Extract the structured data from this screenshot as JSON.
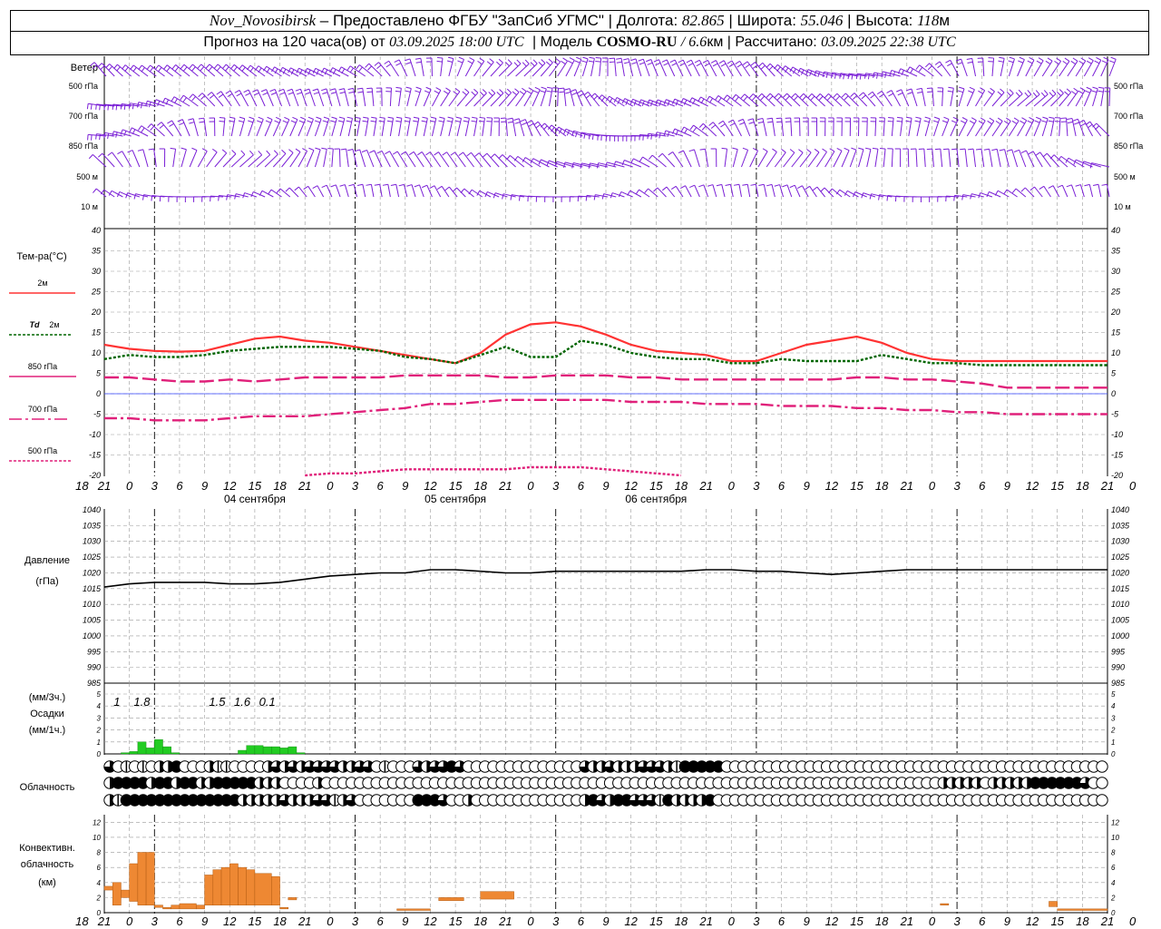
{
  "header": {
    "station": "Nov_Novosibirsk",
    "provider": "– Предоставлено ФГБУ \"ЗапСиб УГМС\"",
    "lon_label": "Долгота:",
    "lon_value": "82.865",
    "lat_label": "Широта:",
    "lat_value": "55.046",
    "alt_label": "Высота:",
    "alt_value": "118",
    "alt_unit": "м",
    "forecast_label": "Прогноз на 120 часа(ов) от",
    "forecast_start": "03.09.2025 18:00 UTC",
    "model_label": "Модель",
    "model_name": "COSMO-RU",
    "model_res": "/ 6.6",
    "model_res_unit": "км",
    "calc_label": "Рассчитано:",
    "calc_time": "03.09.2025 22:38 UTC"
  },
  "chart_data": [
    {
      "type": "wind-barbs",
      "title": "Ветер",
      "levels": [
        "500 гПа",
        "700 гПа",
        "850 гПа",
        "500 м",
        "10 м"
      ],
      "note": "wind barbs every hour for 120 hours at each level"
    },
    {
      "type": "line",
      "title": "Тем-ра(°С)",
      "ylim": [
        -20,
        40
      ],
      "yticks": [
        -20,
        -15,
        -10,
        -5,
        0,
        5,
        10,
        15,
        20,
        25,
        30,
        35,
        40
      ],
      "x_hours": [
        0,
        3,
        6,
        9,
        12,
        15,
        18,
        21,
        24,
        27,
        30,
        33,
        36,
        39,
        42,
        45,
        48,
        51,
        54,
        57,
        60,
        63,
        66,
        69,
        72,
        75,
        78,
        81,
        84,
        87,
        90,
        93,
        96,
        99,
        102,
        105,
        108,
        111,
        114,
        117,
        120
      ],
      "series": [
        {
          "name": "2м",
          "color": "#ff3333",
          "style": "solid",
          "values": [
            12,
            11,
            10.5,
            10.3,
            10.5,
            12,
            13.5,
            14,
            13,
            12.5,
            11.5,
            10.5,
            9.5,
            8.5,
            7.5,
            10,
            14.5,
            17,
            17.5,
            16.5,
            14.5,
            12,
            10.5,
            10,
            9.5,
            8,
            8,
            10,
            12,
            13,
            14,
            12.5,
            10,
            8.5,
            8,
            8,
            8,
            8,
            8,
            8,
            8
          ]
        },
        {
          "name": "Td 2м",
          "color": "#006600",
          "style": "dotted",
          "values": [
            8.5,
            9.5,
            9,
            9,
            9.5,
            10.5,
            11,
            11.5,
            11.5,
            11.5,
            11,
            10.5,
            9,
            8.5,
            7.5,
            9.5,
            11.5,
            9,
            9,
            13,
            12,
            10,
            9,
            8.5,
            8.5,
            7.5,
            7.5,
            8.5,
            8,
            8,
            8,
            9.5,
            8.5,
            7.5,
            7.5,
            7,
            7,
            7,
            7,
            7,
            7
          ]
        },
        {
          "name": "850 гПа",
          "color": "#e0207a",
          "style": "dash",
          "values": [
            4,
            4,
            3.5,
            3,
            3,
            3.5,
            3,
            3.5,
            4,
            4,
            4,
            4,
            4.5,
            4.5,
            4.5,
            4.5,
            4,
            4,
            4.5,
            4.5,
            4.5,
            4,
            4,
            3.5,
            3.5,
            3.5,
            3.5,
            3.5,
            3.5,
            3.5,
            4,
            4,
            3.5,
            3.5,
            3,
            2.5,
            1.5,
            1.5,
            1.5,
            1.5,
            1.5
          ]
        },
        {
          "name": "700 гПа",
          "color": "#e0207a",
          "style": "dashdot",
          "values": [
            -6,
            -6,
            -6.5,
            -6.5,
            -6.5,
            -6,
            -5.5,
            -5.5,
            -5.5,
            -5,
            -4.5,
            -4,
            -3.5,
            -2.5,
            -2.5,
            -2,
            -1.5,
            -1.5,
            -1.5,
            -1.5,
            -1.5,
            -2,
            -2,
            -2,
            -2.5,
            -2.5,
            -2.5,
            -3,
            -3,
            -3,
            -3.5,
            -3.5,
            -4,
            -4,
            -4.5,
            -4.5,
            -5,
            -5,
            -5,
            -5,
            -5
          ]
        },
        {
          "name": "500 гПа",
          "color": "#e0207a",
          "style": "dotted",
          "values": [
            null,
            null,
            null,
            null,
            null,
            null,
            null,
            null,
            -20,
            -19.5,
            -19.5,
            -19,
            -18.5,
            -18.5,
            -18.5,
            -18.5,
            -18.5,
            -18,
            -18,
            -18,
            -18.5,
            -19,
            -19.5,
            -20,
            null,
            null,
            null,
            null,
            null,
            null,
            null,
            null,
            null,
            null,
            null,
            null,
            null,
            null,
            null,
            null,
            null
          ]
        }
      ]
    },
    {
      "type": "line",
      "title": "Давление",
      "ylabel": "(гПа)",
      "ylim": [
        985,
        1040
      ],
      "yticks": [
        985,
        990,
        995,
        1000,
        1005,
        1010,
        1015,
        1020,
        1025,
        1030,
        1035,
        1040
      ],
      "series": [
        {
          "name": "",
          "color": "#000000",
          "values": [
            1015.5,
            1016.5,
            1017,
            1017,
            1017,
            1016.5,
            1016.5,
            1017,
            1018,
            1019,
            1019.5,
            1020,
            1020,
            1021,
            1021,
            1020.5,
            1020,
            1020,
            1020.5,
            1020.5,
            1020.5,
            1020.5,
            1020.5,
            1020.5,
            1021,
            1021,
            1020.5,
            1020.5,
            1020,
            1019.5,
            1020,
            1020.5,
            1021,
            1021,
            1021,
            1021,
            1021,
            1021,
            1021,
            1021,
            1021
          ]
        }
      ]
    },
    {
      "type": "bar",
      "title": "Осадки",
      "ylabel_top": "(мм/3ч.)",
      "ylabel_bottom": "(мм/1ч.)",
      "ylim": [
        0,
        5
      ],
      "yticks": [
        0,
        1,
        2,
        3,
        4,
        5
      ],
      "color": "#22cc22",
      "hourly_start_hours": [
        2,
        3,
        4,
        5,
        6,
        7,
        8,
        16,
        17,
        18,
        19,
        20,
        21,
        22,
        23
      ],
      "hourly_values": [
        0.1,
        0.2,
        1.0,
        0.5,
        1.2,
        0.6,
        0.1,
        0.3,
        0.7,
        0.7,
        0.6,
        0.6,
        0.5,
        0.6,
        0.1
      ],
      "totals_3h": [
        {
          "label": "1",
          "hour": 1.5
        },
        {
          "label": "1.8",
          "hour": 4.5
        },
        {
          "label": "1.5",
          "hour": 13.5
        },
        {
          "label": "1.6",
          "hour": 16.5
        },
        {
          "label": "0.1",
          "hour": 19.5
        }
      ]
    },
    {
      "type": "table",
      "title": "Облачность",
      "legend": "0 clear … 4 overcast, per 1-hour step, three cloud layers (high, middle, low)",
      "rows": [
        [
          3,
          0,
          1,
          0,
          1,
          0,
          2,
          2,
          4,
          0,
          0,
          0,
          2,
          1,
          1,
          0,
          0,
          0,
          0,
          2,
          3,
          2,
          3,
          2,
          3,
          3,
          3,
          3,
          2,
          2,
          3,
          3,
          0,
          1,
          0,
          0,
          0,
          3,
          2,
          3,
          3,
          4,
          3,
          0,
          0,
          0,
          0,
          0,
          0,
          0,
          0,
          0,
          0,
          0,
          0,
          0,
          0,
          3,
          2,
          2,
          3,
          2,
          2,
          2,
          3,
          3,
          3,
          2,
          1,
          4,
          4,
          4,
          4,
          4,
          0,
          0,
          0,
          0,
          0,
          0,
          0,
          0,
          0,
          0,
          0,
          0,
          0,
          0,
          0,
          0,
          0,
          0,
          0,
          0,
          0,
          0,
          0,
          0,
          0,
          0,
          0,
          0,
          0,
          0,
          0,
          0,
          0,
          0,
          0,
          0,
          0,
          0,
          0,
          0,
          0,
          0,
          0,
          0,
          0,
          0
        ],
        [
          2,
          4,
          4,
          4,
          4,
          2,
          4,
          4,
          2,
          4,
          4,
          2,
          2,
          4,
          4,
          4,
          4,
          4,
          2,
          2,
          2,
          0,
          0,
          0,
          0,
          2,
          0,
          0,
          0,
          0,
          0,
          0,
          0,
          0,
          0,
          0,
          0,
          0,
          0,
          0,
          0,
          0,
          0,
          0,
          0,
          0,
          0,
          0,
          0,
          0,
          0,
          0,
          0,
          0,
          0,
          0,
          0,
          0,
          0,
          0,
          0,
          0,
          0,
          0,
          0,
          0,
          0,
          0,
          0,
          0,
          0,
          0,
          0,
          0,
          0,
          0,
          0,
          0,
          0,
          0,
          0,
          0,
          0,
          0,
          0,
          0,
          0,
          0,
          0,
          0,
          0,
          0,
          0,
          0,
          0,
          0,
          0,
          0,
          0,
          0,
          2,
          2,
          2,
          2,
          2,
          0,
          2,
          2,
          2,
          2,
          2,
          4,
          4,
          4,
          4,
          4,
          4,
          3,
          0,
          0
        ],
        [
          2,
          1,
          4,
          4,
          4,
          4,
          4,
          4,
          4,
          4,
          4,
          4,
          4,
          4,
          4,
          4,
          2,
          2,
          2,
          2,
          2,
          3,
          2,
          2,
          2,
          3,
          3,
          1,
          2,
          3,
          0,
          0,
          0,
          0,
          0,
          0,
          0,
          4,
          4,
          4,
          3,
          0,
          0,
          2,
          0,
          0,
          0,
          0,
          0,
          0,
          0,
          0,
          0,
          0,
          0,
          0,
          0,
          2,
          4,
          3,
          2,
          4,
          4,
          3,
          3,
          3,
          1,
          4,
          2,
          2,
          2,
          2,
          4,
          0,
          0,
          0,
          0,
          0,
          0,
          0,
          0,
          0,
          0,
          0,
          0,
          0,
          0,
          0,
          0,
          0,
          0,
          0,
          0,
          0,
          0,
          0,
          0,
          0,
          0,
          0,
          0,
          0,
          0,
          0,
          0,
          0,
          0,
          0,
          0,
          0,
          0,
          0,
          0,
          0,
          0,
          0,
          0,
          0,
          0,
          0
        ]
      ]
    },
    {
      "type": "bar",
      "title": "Конвективн. облачность",
      "ylabel": "(км)",
      "ylim": [
        0,
        13
      ],
      "yticks": [
        0,
        2,
        4,
        6,
        8,
        10,
        12
      ],
      "color": "#ee8833",
      "layers": [
        {
          "start": 0,
          "end": 1,
          "base": 3.0,
          "top": 3.5
        },
        {
          "start": 1,
          "end": 2,
          "base": 1.0,
          "top": 4.0
        },
        {
          "start": 2,
          "end": 3,
          "base": 2.0,
          "top": 3.0
        },
        {
          "start": 3,
          "end": 4,
          "base": 1.5,
          "top": 6.5
        },
        {
          "start": 4,
          "end": 5,
          "base": 1.0,
          "top": 8.0
        },
        {
          "start": 5,
          "end": 6,
          "base": 1.0,
          "top": 8.0
        },
        {
          "start": 6,
          "end": 7,
          "base": 0.7,
          "top": 1.0
        },
        {
          "start": 7,
          "end": 8,
          "base": 0.5,
          "top": 0.7
        },
        {
          "start": 8,
          "end": 9,
          "base": 0.5,
          "top": 1.0
        },
        {
          "start": 9,
          "end": 11,
          "base": 0.5,
          "top": 1.2
        },
        {
          "start": 11,
          "end": 12,
          "base": 0.5,
          "top": 1.0
        },
        {
          "start": 12,
          "end": 13,
          "base": 1.0,
          "top": 5.0
        },
        {
          "start": 13,
          "end": 14,
          "base": 1.0,
          "top": 5.7
        },
        {
          "start": 14,
          "end": 15,
          "base": 1.0,
          "top": 6.0
        },
        {
          "start": 15,
          "end": 16,
          "base": 1.0,
          "top": 6.5
        },
        {
          "start": 16,
          "end": 17,
          "base": 1.0,
          "top": 6.0
        },
        {
          "start": 17,
          "end": 18,
          "base": 1.0,
          "top": 5.7
        },
        {
          "start": 18,
          "end": 20,
          "base": 1.0,
          "top": 5.2
        },
        {
          "start": 20,
          "end": 21,
          "base": 1.0,
          "top": 4.8
        },
        {
          "start": 21,
          "end": 22,
          "base": 0.5,
          "top": 0.7
        },
        {
          "start": 22,
          "end": 23,
          "base": 1.7,
          "top": 2.0
        },
        {
          "start": 35,
          "end": 39,
          "base": 0.3,
          "top": 0.5
        },
        {
          "start": 40,
          "end": 43,
          "base": 1.6,
          "top": 2.0
        },
        {
          "start": 45,
          "end": 49,
          "base": 1.8,
          "top": 2.8
        },
        {
          "start": 100,
          "end": 101,
          "base": 1.0,
          "top": 1.2
        },
        {
          "start": 113,
          "end": 114,
          "base": 0.8,
          "top": 1.5
        },
        {
          "start": 114,
          "end": 120,
          "base": 0.3,
          "top": 0.5
        }
      ]
    }
  ],
  "time_axis": {
    "hours": [
      "18",
      "21",
      "0",
      "3",
      "6",
      "9",
      "12",
      "15",
      "18",
      "21",
      "0",
      "3",
      "6",
      "9",
      "12",
      "15",
      "18",
      "21",
      "0",
      "3",
      "6",
      "9",
      "12",
      "15",
      "18",
      "21",
      "0",
      "3",
      "6",
      "9",
      "12",
      "15",
      "18",
      "21",
      "0",
      "3",
      "6",
      "9",
      "12",
      "15",
      "18",
      "21",
      "0"
    ],
    "days": [
      "04 сентября",
      "05 сентября",
      "06 сентября"
    ]
  },
  "legend": {
    "t2m": "2м",
    "td_prefix": "Td",
    "td_suffix": "2м",
    "t850": "850 гПа",
    "t700": "700 гПа",
    "t500": "500 гПа"
  }
}
